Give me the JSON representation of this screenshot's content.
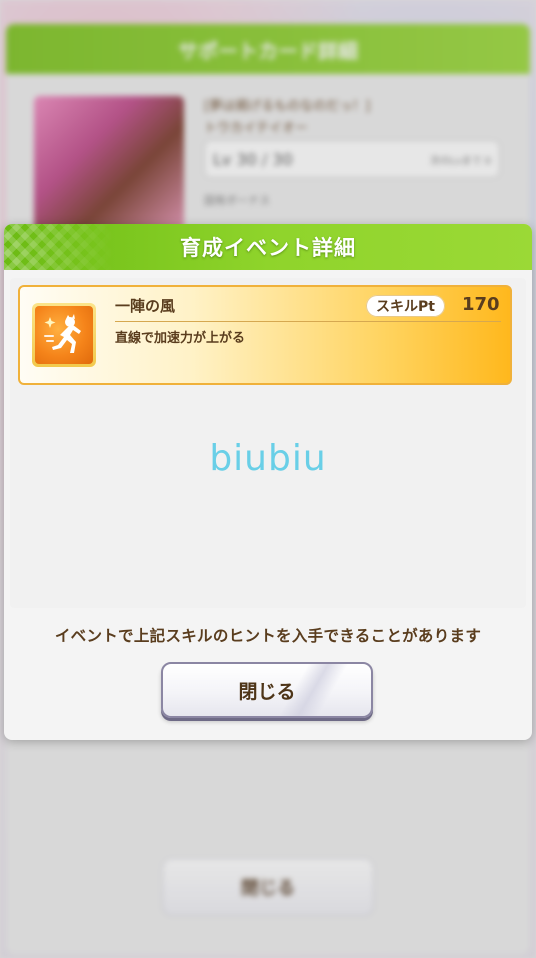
{
  "background": {
    "header_title": "サポートカード詳細",
    "card_name_line1": "[夢は掲げるものなのだっ！]",
    "card_name_line2": "トウカイテイオー",
    "level_text": "Lv 30 / 30",
    "level_note": "次のLvまで 0",
    "bonus_label": "固有ボーナス",
    "close_label": "閉じる"
  },
  "dialog": {
    "title": "育成イベント詳細",
    "skill": {
      "icon": "speed-skill-icon",
      "name": "一陣の風",
      "pt_label": "スキルPt",
      "pt_value": "170",
      "description": "直線で加速力が上がる"
    },
    "watermark": "biubiu",
    "notice": "イベントで上記スキルのヒントを入手できることがあります",
    "close_label": "閉じる"
  },
  "colors": {
    "header_green": "#8fd42b",
    "skill_gold": "#ffb81d",
    "text_brown": "#5a3d1e",
    "watermark_cyan": "#69cfe7"
  }
}
